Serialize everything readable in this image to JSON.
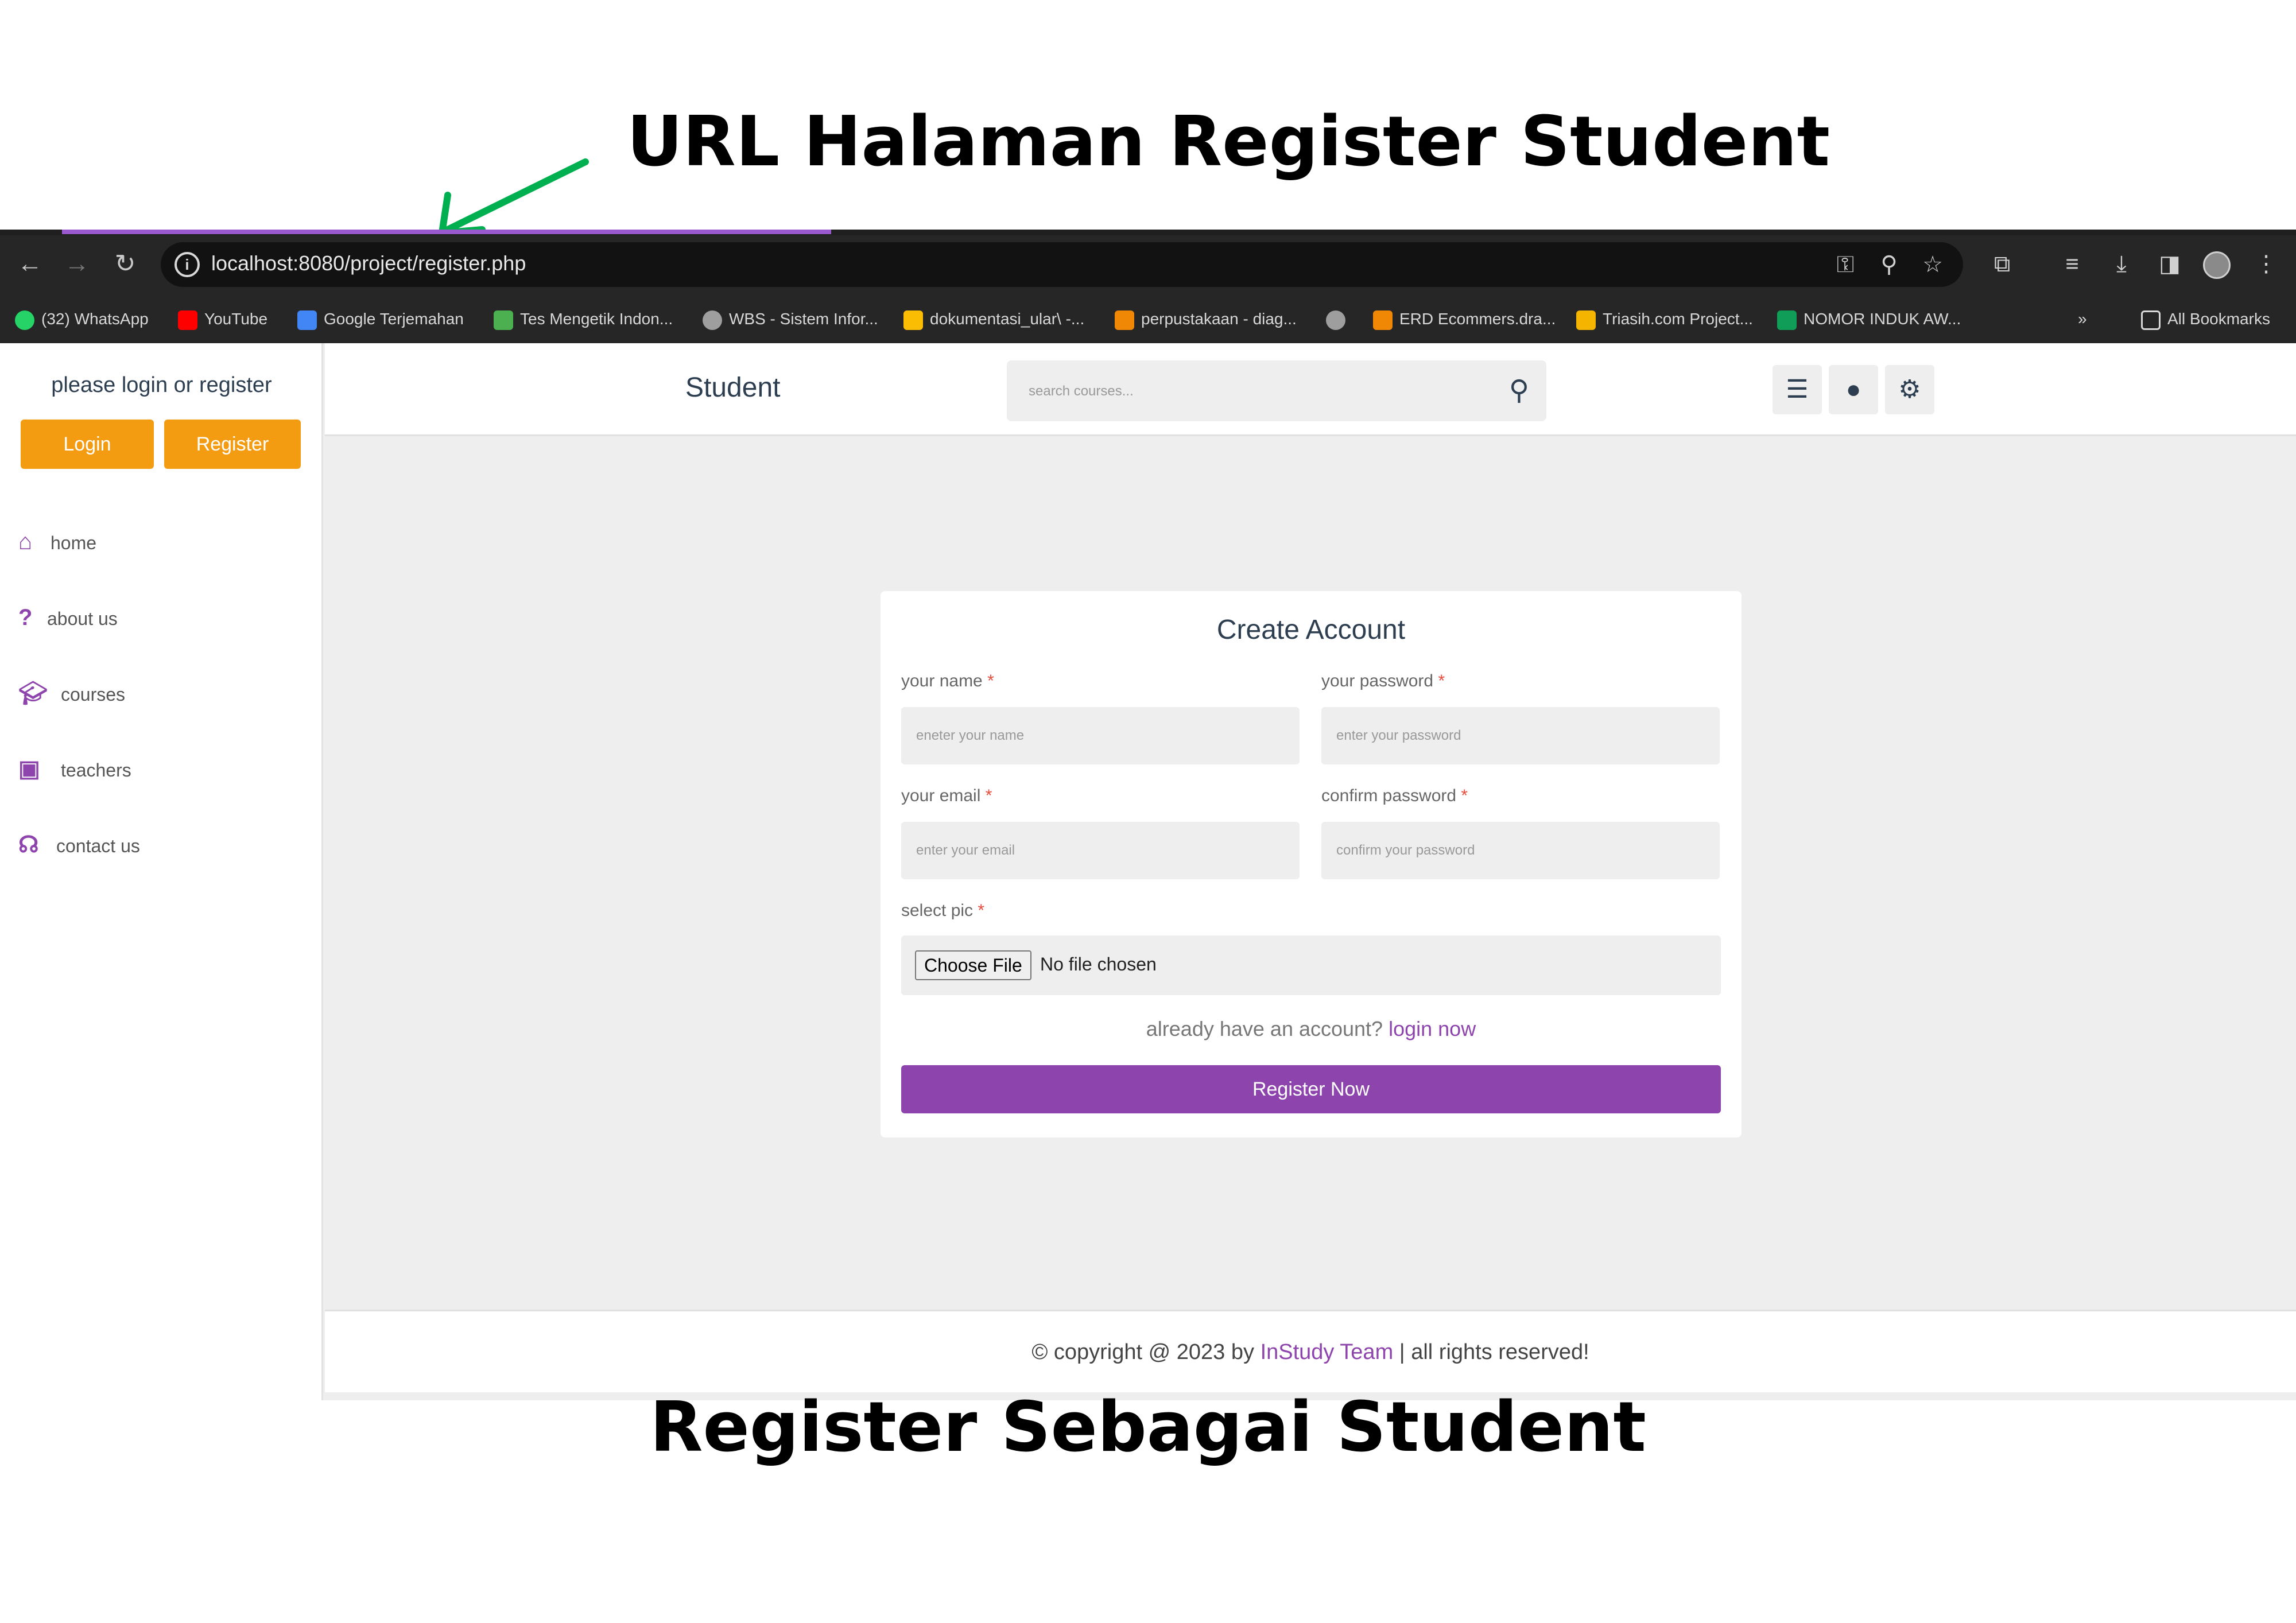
{
  "annotations": {
    "top_title": "URL Halaman Register Student",
    "bottom_title": "Register Sebagai Student",
    "arrow_color": "#00b050"
  },
  "browser": {
    "url": "localhost:8080/project/register.php",
    "bookmarks": [
      {
        "label": "(32) WhatsApp",
        "icon": "whatsapp-icon",
        "color": "#25d366"
      },
      {
        "label": "YouTube",
        "icon": "youtube-icon",
        "color": "#ff0000"
      },
      {
        "label": "Google Terjemahan",
        "icon": "google-translate-icon",
        "color": "#4285f4"
      },
      {
        "label": "Tes Mengetik Indon...",
        "icon": "typing-test-icon",
        "color": "#4caf50"
      },
      {
        "label": "WBS - Sistem Infor...",
        "icon": "globe-icon",
        "color": "#9e9e9e"
      },
      {
        "label": "dokumentasi_ular\\ -...",
        "icon": "google-drive-icon",
        "color": "#fbbc04"
      },
      {
        "label": "perpustakaan - diag...",
        "icon": "drawio-icon",
        "color": "#f08705"
      },
      {
        "label": "",
        "icon": "globe-icon",
        "color": "#9e9e9e"
      },
      {
        "label": "ERD Ecommers.dra...",
        "icon": "drawio-icon",
        "color": "#f08705"
      },
      {
        "label": "Triasih.com Project...",
        "icon": "google-slides-icon",
        "color": "#f4b400"
      },
      {
        "label": "NOMOR INDUK AW...",
        "icon": "google-sheets-icon",
        "color": "#0f9d58"
      }
    ],
    "all_bookmarks_label": "All Bookmarks"
  },
  "sidebar": {
    "greeting": "please login or register",
    "login_label": "Login",
    "register_label": "Register",
    "nav": [
      {
        "label": "home",
        "icon": "home-icon"
      },
      {
        "label": "about us",
        "icon": "question-icon"
      },
      {
        "label": "courses",
        "icon": "graduation-cap-icon"
      },
      {
        "label": "teachers",
        "icon": "chalkboard-teacher-icon"
      },
      {
        "label": "contact us",
        "icon": "headset-icon"
      }
    ]
  },
  "header": {
    "logo": "Student",
    "search_placeholder": "search courses..."
  },
  "form": {
    "title": "Create Account",
    "name_label": "your name",
    "name_placeholder": "eneter your name",
    "password_label": "your password",
    "password_placeholder": "enter your password",
    "email_label": "your email",
    "email_placeholder": "enter your email",
    "confirm_label": "confirm password",
    "confirm_placeholder": "confirm your password",
    "pic_label": "select pic",
    "required_mark": "*",
    "choose_file_label": "Choose File",
    "no_file_text": "No file chosen",
    "already_text": "already have an account?",
    "login_now": "login now",
    "submit_label": "Register Now"
  },
  "footer": {
    "prefix": "© copyright @ 2023 by",
    "team": "InStudy Team",
    "suffix": "| all rights reserved!"
  },
  "colors": {
    "accent": "#8e44ad",
    "orange": "#f39c12",
    "required": "#e74c3c"
  }
}
